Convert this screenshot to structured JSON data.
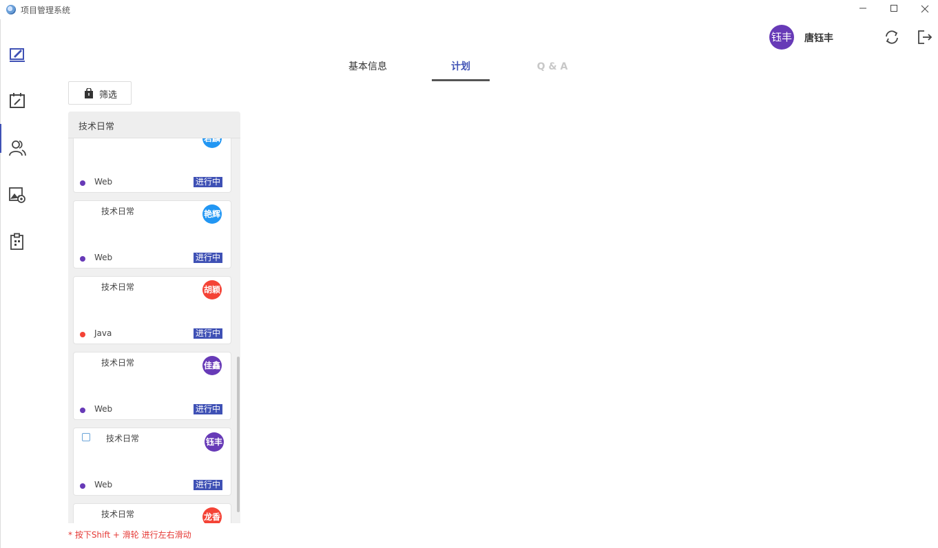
{
  "window": {
    "title": "项目管理系统",
    "minimize": "—",
    "maximize": "☐",
    "close": "✕"
  },
  "sidebar": {
    "items": [
      {
        "icon": "edit-note-icon",
        "active": true
      },
      {
        "icon": "calendar-edit-icon"
      },
      {
        "icon": "people-icon"
      },
      {
        "icon": "image-settings-icon"
      },
      {
        "icon": "clipboard-icon"
      }
    ]
  },
  "user": {
    "avatar_text": "钰丰",
    "name": "唐钰丰",
    "avatar_color": "#673ab7"
  },
  "actions": {
    "refresh_icon": "refresh-icon",
    "logout_icon": "logout-icon"
  },
  "tabs": [
    {
      "label": "基本信息"
    },
    {
      "label": "计划",
      "active": true
    },
    {
      "label": "Q & A",
      "disabled": true
    }
  ],
  "filter": {
    "label": "筛选",
    "icon": "shopping-bag-icon"
  },
  "column": {
    "title": "技术日常",
    "cards": [
      {
        "title": "",
        "avatar": "若麟",
        "avatar_color": "#2196f3",
        "tech": "Web",
        "tech_color": "#673ab7",
        "status": "进行中"
      },
      {
        "title": "技术日常",
        "avatar": "艳辉",
        "avatar_color": "#2196f3",
        "tech": "Web",
        "tech_color": "#673ab7",
        "status": "进行中"
      },
      {
        "title": "技术日常",
        "avatar": "胡颖",
        "avatar_color": "#f44336",
        "tech": "Java",
        "tech_color": "#f44336",
        "status": "进行中"
      },
      {
        "title": "技术日常",
        "avatar": "佳鑫",
        "avatar_color": "#673ab7",
        "tech": "Web",
        "tech_color": "#673ab7",
        "status": "进行中"
      },
      {
        "title": "技术日常",
        "avatar": "钰丰",
        "avatar_color": "#673ab7",
        "tech": "Web",
        "tech_color": "#673ab7",
        "status": "进行中",
        "checkbox": true
      },
      {
        "title": "技术日常",
        "avatar": "龙香",
        "avatar_color": "#f44336",
        "tech": "",
        "tech_color": "",
        "status": ""
      }
    ]
  },
  "hint": "* 按下Shift + 滑轮 进行左右滑动",
  "colors": {
    "accent": "#3f51b5",
    "hint": "#e53935"
  }
}
